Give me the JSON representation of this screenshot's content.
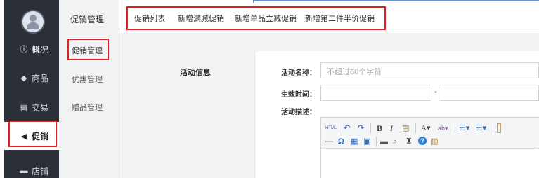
{
  "sidebar": {
    "items": [
      {
        "label": "概况",
        "icon": "info-icon"
      },
      {
        "label": "商品",
        "icon": "tag-icon"
      },
      {
        "label": "交易",
        "icon": "document-icon"
      },
      {
        "label": "促销",
        "icon": "megaphone-icon"
      },
      {
        "label": "店铺",
        "icon": "store-icon"
      }
    ],
    "active": "促销"
  },
  "subnav": {
    "title": "促销管理",
    "items": [
      {
        "label": "促销管理"
      },
      {
        "label": "优惠管理"
      },
      {
        "label": "赠品管理"
      }
    ],
    "active": "促销管理"
  },
  "tabs": [
    {
      "label": "促销列表"
    },
    {
      "label": "新增满减促销"
    },
    {
      "label": "新增单品立减促销"
    },
    {
      "label": "新增第二件半价促销"
    }
  ],
  "form": {
    "section_title": "活动信息",
    "name_label": "活动名称：",
    "name_placeholder": "不超过60个字符",
    "time_label": "生效时间：",
    "time_separator": "-",
    "desc_label": "活动描述："
  },
  "editor": {
    "toolbar_row1": [
      {
        "icon": "html-source-icon",
        "text": "HTML"
      },
      {
        "icon": "undo-icon",
        "text": "↶"
      },
      {
        "icon": "redo-icon",
        "text": "↷"
      },
      {
        "icon": "bold-icon",
        "text": "B"
      },
      {
        "icon": "italic-icon",
        "text": "I"
      },
      {
        "icon": "paste-icon",
        "text": "▤"
      },
      {
        "icon": "font-color-icon",
        "text": "A▾"
      },
      {
        "icon": "highlight-icon",
        "text": "ab▾"
      },
      {
        "icon": "ordered-list-icon",
        "text": "☰▾"
      },
      {
        "icon": "unordered-list-icon",
        "text": "☰▾"
      }
    ],
    "toolbar_row2": [
      {
        "icon": "horizontal-rule-icon",
        "text": "—"
      },
      {
        "icon": "special-char-icon",
        "text": "Ω"
      },
      {
        "icon": "table-icon",
        "text": "▦"
      },
      {
        "icon": "insert-image-icon",
        "text": "▣"
      },
      {
        "icon": "print-icon",
        "text": "▬"
      },
      {
        "icon": "preview-icon",
        "text": "⌕"
      },
      {
        "icon": "find-icon",
        "text": "♜"
      },
      {
        "icon": "help-icon",
        "text": "?"
      },
      {
        "icon": "template-icon",
        "text": "▥"
      }
    ]
  },
  "colors": {
    "sidebar_bg": "#2b2f38",
    "highlight_red": "#e02020",
    "help_blue": "#2f7fd6"
  }
}
